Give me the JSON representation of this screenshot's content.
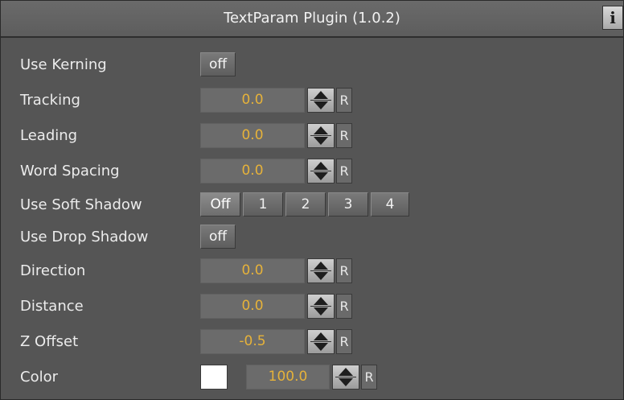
{
  "header": {
    "title": "TextParam Plugin (1.0.2)",
    "info_label": "i"
  },
  "params": {
    "use_kerning": {
      "label": "Use Kerning",
      "value": "off"
    },
    "tracking": {
      "label": "Tracking",
      "value": "0.0",
      "reset": "R"
    },
    "leading": {
      "label": "Leading",
      "value": "0.0",
      "reset": "R"
    },
    "word_spacing": {
      "label": "Word Spacing",
      "value": "0.0",
      "reset": "R"
    },
    "use_soft_shadow": {
      "label": "Use Soft Shadow",
      "options": [
        "Off",
        "1",
        "2",
        "3",
        "4"
      ],
      "selected": "Off"
    },
    "use_drop_shadow": {
      "label": "Use Drop Shadow",
      "value": "off"
    },
    "direction": {
      "label": "Direction",
      "value": "0.0",
      "reset": "R"
    },
    "distance": {
      "label": "Distance",
      "value": "0.0",
      "reset": "R"
    },
    "z_offset": {
      "label": "Z Offset",
      "value": "-0.5",
      "reset": "R"
    },
    "color": {
      "label": "Color",
      "swatch": "#ffffff",
      "value": "100.0",
      "reset": "R"
    }
  },
  "colors": {
    "panel_bg": "#555555",
    "value_text": "#e6b23a",
    "field_bg": "#6b6b6b"
  }
}
